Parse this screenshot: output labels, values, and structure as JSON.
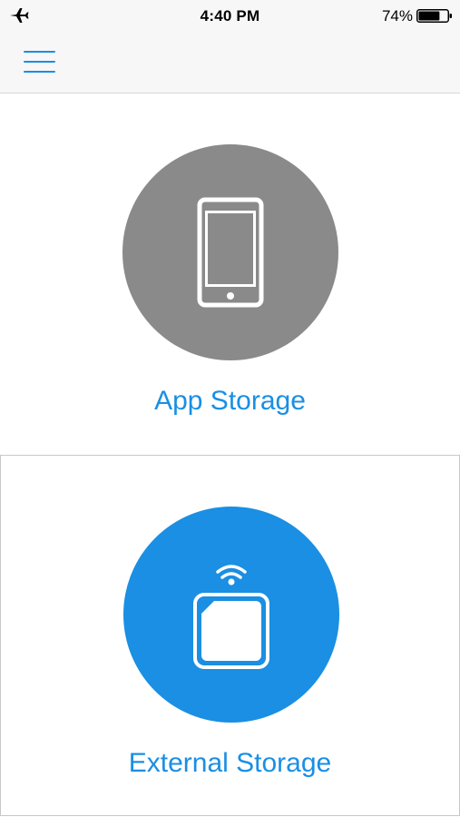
{
  "status_bar": {
    "time": "4:40 PM",
    "battery_percent": "74%",
    "battery_level": 0.74,
    "airplane_mode_icon": "airplane-icon"
  },
  "nav_bar": {
    "menu_icon": "hamburger-menu-icon"
  },
  "storage_options": {
    "app_storage": {
      "label": "App Storage",
      "icon": "phone-icon",
      "circle_color": "#8a8a8a"
    },
    "external_storage": {
      "label": "External Storage",
      "icon": "wireless-drive-icon",
      "circle_color": "#1a8fe3"
    }
  },
  "colors": {
    "accent": "#1a8fe3",
    "nav_background": "#f7f7f7"
  }
}
